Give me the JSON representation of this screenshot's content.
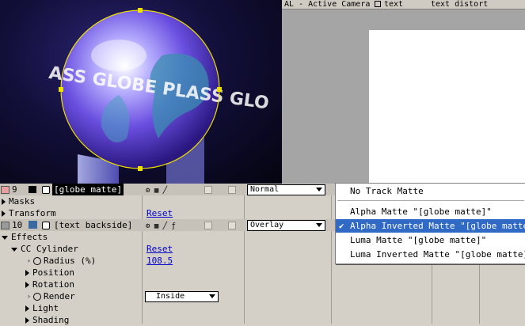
{
  "tabs": [
    {
      "label": "AL - Active Camera"
    },
    {
      "label": "text"
    },
    {
      "label": "text distort"
    }
  ],
  "globe_text": "ASS GLOBE PLASS GLO",
  "layers": [
    {
      "number": "9",
      "name": "[globe matte]",
      "color": "#e8a0a0",
      "mode": "Normal"
    },
    {
      "number": "10",
      "name": "[text backside]",
      "color": "#9a9a9a",
      "mode": "Overlay"
    }
  ],
  "rows": {
    "masks": "Masks",
    "transform": "Transform",
    "transform_reset": "Reset",
    "effects": "Effects",
    "cc_cylinder": "CC Cylinder",
    "cc_reset": "Reset",
    "radius_label": "Radius (%)",
    "radius_value": "108.5",
    "position": "Position",
    "rotation": "Rotation",
    "render": "Render",
    "render_value": "Inside",
    "light": "Light",
    "shading": "Shading"
  },
  "track_matte_menu": {
    "items": [
      {
        "label": "No Track Matte"
      },
      {
        "label": "Alpha Matte \"[globe matte]\""
      },
      {
        "label": "Alpha Inverted Matte \"[globe matte]\"",
        "checked": true
      },
      {
        "label": "Luma Matte \"[globe matte]\""
      },
      {
        "label": "Luma Inverted Matte \"[globe matte]\""
      }
    ],
    "checkmark": "✔"
  },
  "colors": {
    "accent": "#316ac5",
    "link": "#0000c8",
    "selection": "#e8d000"
  }
}
